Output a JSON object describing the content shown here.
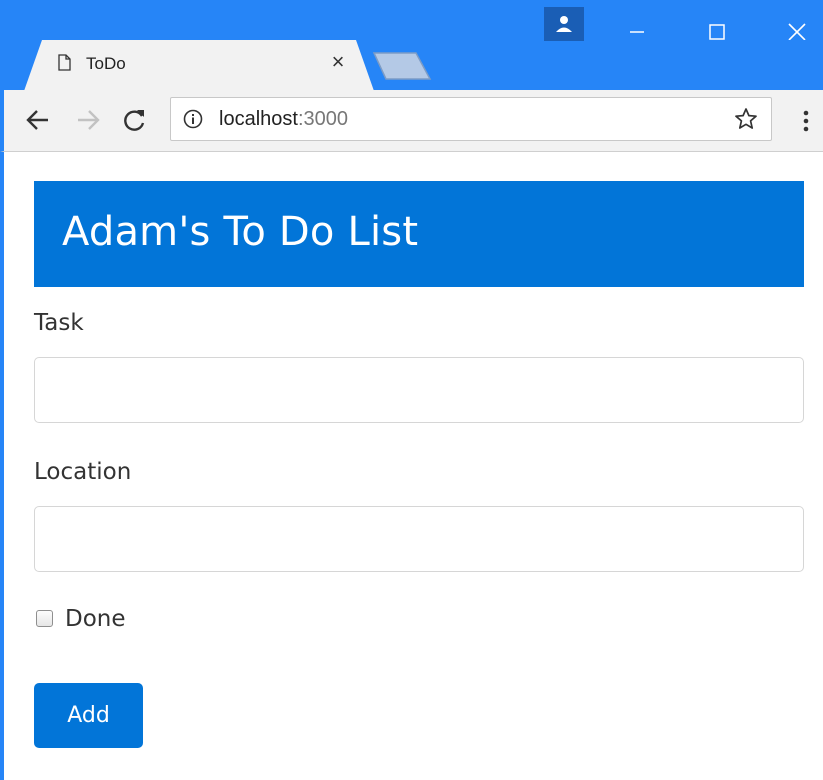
{
  "browser": {
    "tab": {
      "title": "ToDo",
      "close_glyph": "×",
      "icon": "document-icon"
    },
    "new_tab_icon": "new-tab-icon",
    "profile_icon": "person-icon",
    "window_controls": [
      "minimize-icon",
      "maximize-icon",
      "close-icon"
    ],
    "nav": {
      "back_icon": "arrow-left-icon",
      "forward_icon": "arrow-right-icon",
      "reload_icon": "reload-icon"
    },
    "address_bar": {
      "host": "localhost",
      "port": ":3000",
      "info_icon": "info-icon",
      "star_icon": "star-icon"
    },
    "menu_icon": "vertical-dots-icon"
  },
  "page": {
    "header_title": "Adam's To Do List",
    "form": {
      "task_label": "Task",
      "task_value": "",
      "location_label": "Location",
      "location_value": "",
      "done_label": "Done",
      "done_checked": false,
      "submit_label": "Add"
    }
  },
  "colors": {
    "browser_chrome": "#2685f7",
    "primary": "#0275d8",
    "toolbar": "#f2f2f2"
  }
}
